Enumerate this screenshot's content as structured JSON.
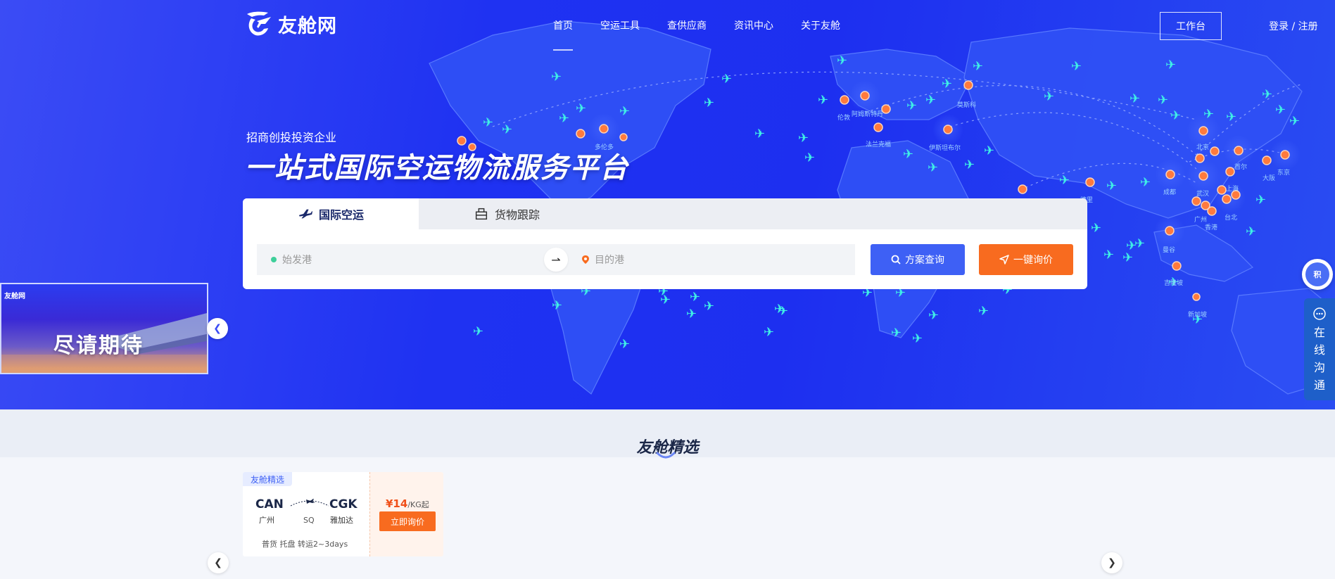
{
  "brand": {
    "name": "友舱网"
  },
  "nav": {
    "items": [
      {
        "label": "首页",
        "active": true
      },
      {
        "label": "空运工具",
        "active": false
      },
      {
        "label": "查供应商",
        "active": false
      },
      {
        "label": "资讯中心",
        "active": false
      },
      {
        "label": "关于友舱",
        "active": false
      }
    ],
    "workbench_label": "工作台",
    "login_label": "登录 / 注册"
  },
  "hero": {
    "subtitle": "招商创投投资企业",
    "title": "一站式国际空运物流服务平台"
  },
  "search": {
    "tabs": [
      {
        "label": "国际空运",
        "icon": "airplane-icon",
        "active": true
      },
      {
        "label": "货物跟踪",
        "icon": "package-icon",
        "active": false
      }
    ],
    "origin_placeholder": "始发港",
    "destination_placeholder": "目的港",
    "swap_symbol": "⇀",
    "query_button": "方案查询",
    "quote_button": "一键询价"
  },
  "promo": {
    "brand": "友舱网",
    "text": "尽请期待"
  },
  "widgets": {
    "float_label": "积",
    "chat_chars": [
      "在",
      "线",
      "沟",
      "通"
    ]
  },
  "map": {
    "city_labels": [
      "多伦多",
      "伦敦",
      "阿姆斯特丹",
      "法兰克福",
      "莫斯科",
      "伊斯坦布尔",
      "北京",
      "首尔",
      "大阪",
      "东京",
      "成都",
      "武汉",
      "上海",
      "广州",
      "香港",
      "台北",
      "曼谷",
      "吉隆坡",
      "新加坡",
      "德里"
    ]
  },
  "selection": {
    "title": "友舱精选",
    "cards": [
      {
        "tag": "友舱精选",
        "from_code": "CAN",
        "from_city": "广州",
        "to_code": "CGK",
        "to_city": "雅加达",
        "airline": "SQ",
        "meta": "普货 托盘 转运2~3days",
        "price": "¥14",
        "price_unit": "/KG起",
        "ask_button": "立即询价"
      }
    ]
  },
  "colors": {
    "hero_blue": "#1f32f2",
    "accent_blue": "#3e60f5",
    "accent_orange": "#f86b1f",
    "chat_blue": "#1e5fc9"
  }
}
